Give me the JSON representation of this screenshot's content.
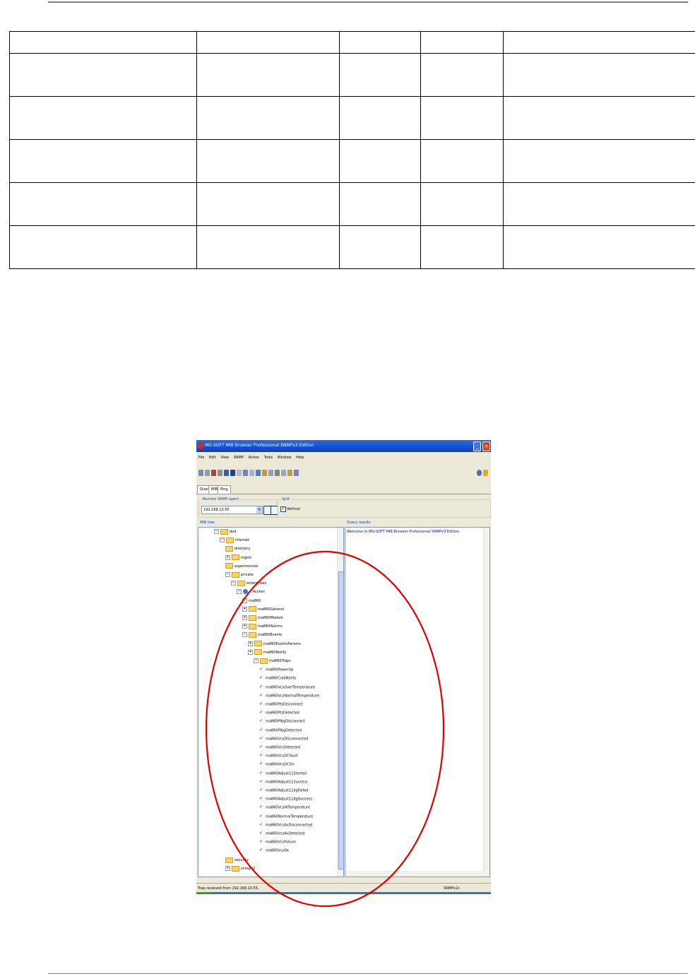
{
  "document": {
    "table": {
      "columns": 5,
      "rows": 5,
      "cells": [
        [
          "",
          "",
          "",
          "",
          ""
        ],
        [
          "",
          "",
          "",
          "",
          ""
        ],
        [
          "",
          "",
          "",
          "",
          ""
        ],
        [
          "",
          "",
          "",
          "",
          ""
        ],
        [
          "",
          "",
          "",
          "",
          ""
        ],
        [
          "",
          "",
          "",
          "",
          ""
        ]
      ]
    }
  },
  "screenshot": {
    "window_title": "MG-SOFT MIB Browser Professional SNMPv3 Edition",
    "menu": [
      "File",
      "Edit",
      "View",
      "SNMP",
      "Action",
      "Tools",
      "Window",
      "Help"
    ],
    "tabs": [
      "Query",
      "MIB",
      "Ping"
    ],
    "active_tab": "Query",
    "remote_agent_label": "Remote SNMP agent",
    "remote_agent_value": "192.168.10.55",
    "split_label": "Split",
    "vertical_label": "Vertical",
    "vertical_checked": true,
    "mib_tree_label": "MIB tree",
    "query_results_label": "Query results",
    "query_results_text": "Welcome to MG-SOFT MIB Browser Professional SNMPv3 Edition",
    "tree": [
      {
        "label": "dod",
        "icon": "folder-icon",
        "expander": "−"
      },
      {
        "label": "internet",
        "icon": "folder-icon",
        "expander": "−"
      },
      {
        "label": "directory",
        "icon": "folder-icon",
        "expander": ""
      },
      {
        "label": "mgmt",
        "icon": "folder-icon",
        "expander": "+"
      },
      {
        "label": "experimental",
        "icon": "folder-icon",
        "expander": ""
      },
      {
        "label": "private",
        "icon": "folder-icon",
        "expander": "−"
      },
      {
        "label": "enterprises",
        "icon": "folder-icon",
        "expander": "−"
      },
      {
        "label": "...Access",
        "icon": "module-icon",
        "expander": "−"
      },
      {
        "label": "ma860",
        "icon": "none",
        "expander": "−"
      },
      {
        "label": "ma860General",
        "icon": "folder-icon",
        "expander": "+"
      },
      {
        "label": "ma860Module",
        "icon": "folder-icon",
        "expander": "+"
      },
      {
        "label": "ma860Alarms",
        "icon": "folder-icon",
        "expander": "+"
      },
      {
        "label": "ma860Events",
        "icon": "folder-icon",
        "expander": "−"
      },
      {
        "label": "ma860EventsParams",
        "icon": "folder-icon",
        "expander": "+"
      },
      {
        "label": "ma860Notify",
        "icon": "folder-icon",
        "expander": "+"
      },
      {
        "label": "ma860Traps",
        "icon": "folder-icon",
        "expander": "−"
      },
      {
        "label": "ma860PowerUp",
        "icon": "trap-icon",
        "expander": ""
      },
      {
        "label": "ma860ColdNotify",
        "icon": "trap-icon",
        "expander": ""
      },
      {
        "label": "ma860VcsOverTemperature",
        "icon": "trap-icon",
        "expander": ""
      },
      {
        "label": "ma860VcsNormalTemperature",
        "icon": "trap-icon",
        "expander": ""
      },
      {
        "label": "ma860PtsDisconnect",
        "icon": "trap-icon",
        "expander": ""
      },
      {
        "label": "ma860PtsDetected",
        "icon": "trap-icon",
        "expander": ""
      },
      {
        "label": "ma860PlbgDisconnect",
        "icon": "trap-icon",
        "expander": ""
      },
      {
        "label": "ma860PlbgDetected",
        "icon": "trap-icon",
        "expander": ""
      },
      {
        "label": "ma860VcsDisconnected",
        "icon": "trap-icon",
        "expander": ""
      },
      {
        "label": "ma860VcsDetected",
        "icon": "trap-icon",
        "expander": ""
      },
      {
        "label": "ma860VcsDCFault",
        "icon": "trap-icon",
        "expander": ""
      },
      {
        "label": "ma860VcsDCOn",
        "icon": "trap-icon",
        "expander": ""
      },
      {
        "label": "ma860Adjust11Started",
        "icon": "trap-icon",
        "expander": ""
      },
      {
        "label": "ma860Adjust11Success",
        "icon": "trap-icon",
        "expander": ""
      },
      {
        "label": "ma860Adjust11bgFailed",
        "icon": "trap-icon",
        "expander": ""
      },
      {
        "label": "ma860Adjust11bgSuccess",
        "icon": "trap-icon",
        "expander": ""
      },
      {
        "label": "ma860VcsHiTemperature",
        "icon": "trap-icon",
        "expander": ""
      },
      {
        "label": "ma860NormalTemperature",
        "icon": "trap-icon",
        "expander": ""
      },
      {
        "label": "ma860VcsAvDisconnected",
        "icon": "trap-icon",
        "expander": ""
      },
      {
        "label": "ma860VcsAvDetected",
        "icon": "trap-icon",
        "expander": ""
      },
      {
        "label": "ma860VcsFailure",
        "icon": "trap-icon",
        "expander": ""
      },
      {
        "label": "ma860VcsOk",
        "icon": "trap-icon",
        "expander": ""
      },
      {
        "label": "security",
        "icon": "folder-icon",
        "expander": ""
      },
      {
        "label": "snmpV2",
        "icon": "folder-icon",
        "expander": "+"
      }
    ],
    "status_text": "Trap received from 192.168.10.55.",
    "status_protocol": "SNMPv2c",
    "highlight_color": "#e00000"
  }
}
